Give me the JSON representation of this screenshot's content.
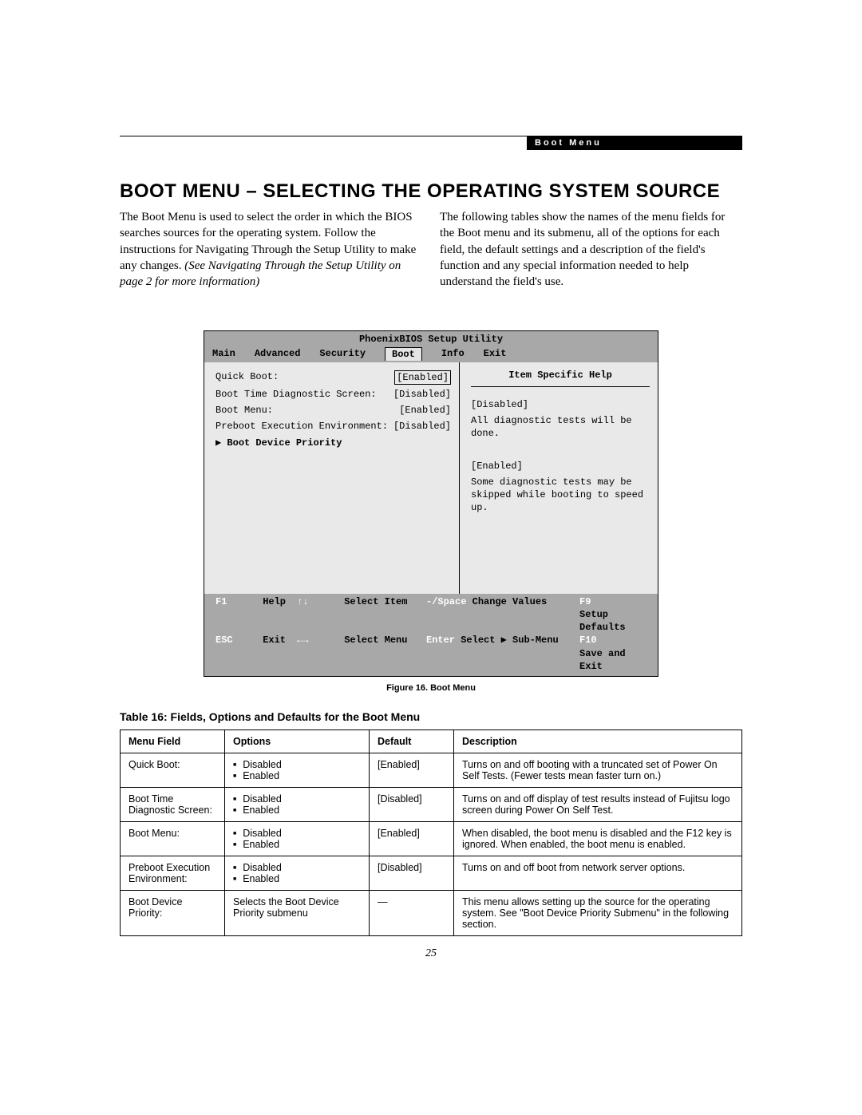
{
  "header": {
    "section_label": "Boot Menu",
    "title": "BOOT MENU – SELECTING THE OPERATING SYSTEM SOURCE"
  },
  "intro": {
    "para1": "The Boot Menu is used to select the order in which the BIOS searches sources for the operating system. Follow the instructions for Navigating Through the Setup Utility to make any changes. ",
    "para1_em": "(See Navigating Through the Setup Utility on page 2 for more information)",
    "para2": "The following tables show the names of the menu fields for the Boot menu and its submenu, all of the options for each field, the default settings and a description of the field's function and any special information needed to help understand the field's use."
  },
  "bios": {
    "title": "PhoenixBIOS Setup Utility",
    "tabs": [
      "Main",
      "Advanced",
      "Security",
      "Boot",
      "Info",
      "Exit"
    ],
    "active_tab": "Boot",
    "items": [
      {
        "label": "Quick Boot:",
        "value": "[Enabled]",
        "selected": true
      },
      {
        "label": "Boot Time Diagnostic Screen:",
        "value": "[Disabled]",
        "selected": false
      },
      {
        "label": "Boot Menu:",
        "value": "[Enabled]",
        "selected": false
      },
      {
        "label": "Preboot Execution Environment:",
        "value": "[Disabled]",
        "selected": false
      }
    ],
    "submenu_label": "▶ Boot Device Priority",
    "help_title": "Item Specific Help",
    "help_lines": [
      "[Disabled]",
      "All diagnostic tests will be done.",
      "",
      "[Enabled]",
      "Some diagnostic tests may be skipped while booting to speed up."
    ],
    "footer": {
      "f1": "F1",
      "help": "Help",
      "esc": "ESC",
      "exit": "Exit",
      "sel_item_keys": "↑↓",
      "sel_item": "Select Item",
      "sel_menu_keys": "←→",
      "sel_menu": "Select Menu",
      "change_keys": "-/Space",
      "change": "Change Values",
      "enter_key": "Enter",
      "enter": "Select ▶ Sub-Menu",
      "f9": "F9",
      "setup_defaults": "Setup Defaults",
      "f10": "F10",
      "save_exit": "Save and Exit"
    }
  },
  "figure_caption": "Figure 16.   Boot Menu",
  "table_caption": "Table 16: Fields, Options and Defaults for the Boot Menu",
  "table": {
    "headers": [
      "Menu Field",
      "Options",
      "Default",
      "Description"
    ],
    "rows": [
      {
        "field": "Quick Boot:",
        "options": [
          "Disabled",
          "Enabled"
        ],
        "default": "[Enabled]",
        "desc": "Turns on and off booting with a truncated set of Power On Self Tests. (Fewer tests mean faster turn on.)"
      },
      {
        "field": "Boot Time Diagnostic Screen:",
        "options": [
          "Disabled",
          "Enabled"
        ],
        "default": "[Disabled]",
        "desc": "Turns on and off display of test results instead of Fujitsu logo screen during Power On Self Test."
      },
      {
        "field": "Boot Menu:",
        "options": [
          "Disabled",
          "Enabled"
        ],
        "default": "[Enabled]",
        "desc": "When disabled, the boot menu is disabled and the F12 key is ignored. When enabled, the boot menu is enabled."
      },
      {
        "field": "Preboot Execution Environment:",
        "options": [
          "Disabled",
          "Enabled"
        ],
        "default": "[Disabled]",
        "desc": "Turns on and off boot from network server options."
      },
      {
        "field": "Boot Device Priority:",
        "options_text": "Selects the Boot Device Priority submenu",
        "default": "—",
        "desc": "This menu allows setting up the source for the operating system. See \"Boot Device Priority Submenu\" in the following section."
      }
    ]
  },
  "page_number": "25"
}
